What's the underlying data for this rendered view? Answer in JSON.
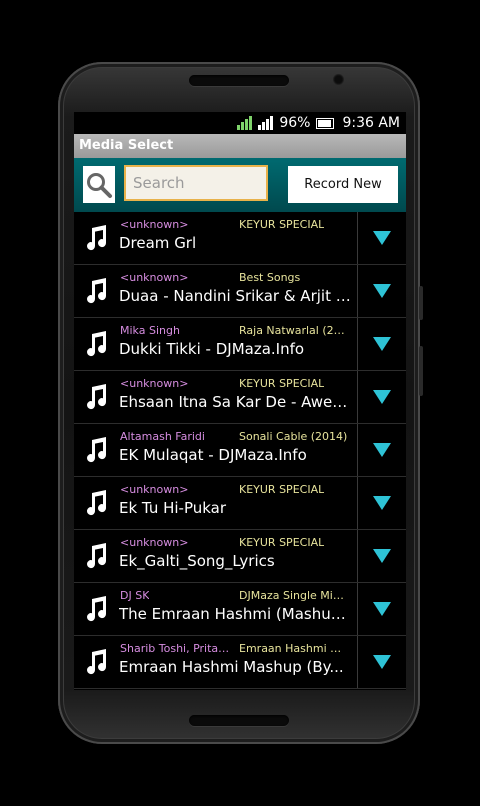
{
  "status": {
    "battery": "96%",
    "time": "9:36 AM"
  },
  "app": {
    "title": "Media Select"
  },
  "search": {
    "placeholder": "Search",
    "record_label": "Record New"
  },
  "icons": {
    "search": "search-icon",
    "note": "music-note-icon",
    "expand": "expand-arrow-icon"
  },
  "colors": {
    "accent": "#2ec3d6",
    "artist": "#d68de0",
    "album": "#e7e39c",
    "searchbar": "#00555a"
  },
  "songs": [
    {
      "artist": "<unknown>",
      "album": "KEYUR SPECIAL",
      "title": "Dream Grl"
    },
    {
      "artist": "<unknown>",
      "album": "Best Songs",
      "title": "Duaa - Nandini Srikar & Arjit S..."
    },
    {
      "artist": "Mika Singh",
      "album": "Raja Natwarlal (2014)",
      "title": "Dukki Tikki - DJMaza.Info"
    },
    {
      "artist": "<unknown>",
      "album": "KEYUR SPECIAL",
      "title": "Ehsaan Itna Sa Kar De - Awes..."
    },
    {
      "artist": "Altamash Faridi",
      "album": "Sonali Cable (2014)",
      "title": "EK Mulaqat - DJMaza.Info"
    },
    {
      "artist": "<unknown>",
      "album": "KEYUR SPECIAL",
      "title": "Ek Tu Hi-Pukar"
    },
    {
      "artist": "<unknown>",
      "album": "KEYUR SPECIAL",
      "title": "Ek_Galti_Song_Lyrics"
    },
    {
      "artist": "DJ SK",
      "album": "DJMaza Single Mixes",
      "title": "The Emraan Hashmi (Mashup..."
    },
    {
      "artist": "Sharib Toshi, Pritam...",
      "album": "Emraan Hashmi Mas...",
      "title": "Emraan Hashmi Mashup (By..."
    }
  ]
}
